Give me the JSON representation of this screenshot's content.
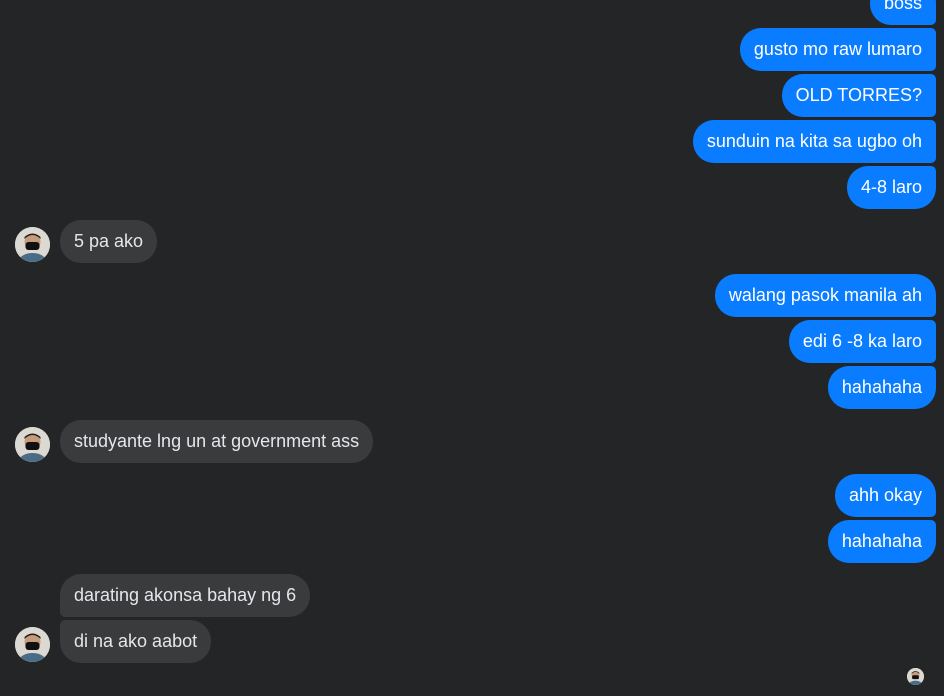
{
  "messages": {
    "m1": "boss",
    "m2": "gusto mo raw lumaro",
    "m3": "OLD TORRES?",
    "m4": "sunduin na kita sa ugbo oh",
    "m5": "4-8 laro",
    "m6": "5 pa ako",
    "m7": "walang pasok manila ah",
    "m8": "edi 6 -8 ka laro",
    "m9": "hahahaha",
    "m10": "studyante lng un at government ass",
    "m11": "ahh okay",
    "m12": "hahahaha",
    "m13": "darating akonsa bahay ng 6",
    "m14": "di na ako aabot"
  },
  "colors": {
    "background": "#242526",
    "outgoing_bubble": "#0A7CFF",
    "incoming_bubble": "#3A3B3C"
  },
  "icons": {
    "contact_avatar": "masked-person-avatar",
    "seen_indicator": "seen-avatar"
  }
}
